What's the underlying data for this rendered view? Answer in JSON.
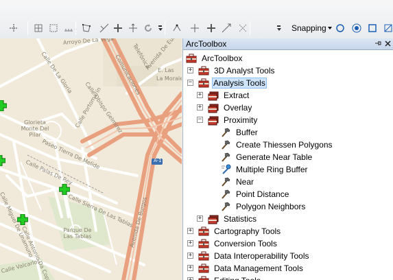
{
  "toolbar": {
    "snapping_label": "Snapping",
    "icons": [
      "pan-icon",
      "grid-icon",
      "measure-icon",
      "vertex-icon",
      "split-icon",
      "reshape-icon",
      "rotate-icon",
      "edit-vertices-icon",
      "snap-point-icon",
      "snap-end-icon",
      "snap-vertex-icon",
      "snap-edge-icon",
      "topology-icon"
    ]
  },
  "map": {
    "labels": [
      "Arroyo De La Vega",
      "Calle De La Gloria",
      "Calle Obispo Gelmirez",
      "Avenida De Europa",
      "Comunicaciones",
      "Telefónica",
      "E. Las",
      "La Moraleja",
      "Calle Portomarín",
      "Glorieta Monte Del Pilar",
      "Paseo Tierra De Melide",
      "Calle Palas De Rey",
      "Avenida De Burgos",
      "A-1",
      "Parque De Las Tablas",
      "Calle Sierra De Las Tablas",
      "Calle Miguel De Unamuno",
      "Calle Valcarlos",
      "Calle Antonio Da Coppola"
    ]
  },
  "panel": {
    "title": "ArcToolbox",
    "pin_icon": "pin-icon",
    "close_icon": "close-icon",
    "tree": [
      {
        "label": "ArcToolbox",
        "icon": "toolbox-icon",
        "level": 0,
        "expander": ""
      },
      {
        "label": "3D Analyst Tools",
        "icon": "toolbox-icon",
        "level": 1,
        "expander": "+"
      },
      {
        "label": "Analysis Tools",
        "icon": "toolbox-icon",
        "level": 1,
        "expander": "-",
        "selected": true
      },
      {
        "label": "Extract",
        "icon": "toolset-icon",
        "level": 2,
        "expander": "+"
      },
      {
        "label": "Overlay",
        "icon": "toolset-icon",
        "level": 2,
        "expander": "+"
      },
      {
        "label": "Proximity",
        "icon": "toolset-icon",
        "level": 2,
        "expander": "-"
      },
      {
        "label": "Buffer",
        "icon": "hammer-icon",
        "level": 3,
        "expander": ""
      },
      {
        "label": "Create Thiessen Polygons",
        "icon": "hammer-icon",
        "level": 3,
        "expander": ""
      },
      {
        "label": "Generate Near Table",
        "icon": "hammer-icon",
        "level": 3,
        "expander": ""
      },
      {
        "label": "Multiple Ring Buffer",
        "icon": "script-icon",
        "level": 3,
        "expander": ""
      },
      {
        "label": "Near",
        "icon": "hammer-icon",
        "level": 3,
        "expander": ""
      },
      {
        "label": "Point Distance",
        "icon": "hammer-icon",
        "level": 3,
        "expander": ""
      },
      {
        "label": "Polygon Neighbors",
        "icon": "hammer-icon",
        "level": 3,
        "expander": ""
      },
      {
        "label": "Statistics",
        "icon": "toolset-icon",
        "level": 2,
        "expander": "+"
      },
      {
        "label": "Cartography Tools",
        "icon": "toolbox-icon",
        "level": 1,
        "expander": "+"
      },
      {
        "label": "Conversion Tools",
        "icon": "toolbox-icon",
        "level": 1,
        "expander": "+"
      },
      {
        "label": "Data Interoperability Tools",
        "icon": "toolbox-icon",
        "level": 1,
        "expander": "+"
      },
      {
        "label": "Data Management Tools",
        "icon": "toolbox-icon",
        "level": 1,
        "expander": "+"
      },
      {
        "label": "Editing Tools",
        "icon": "toolbox-icon",
        "level": 1,
        "expander": "+"
      }
    ]
  },
  "colors": {
    "map_bg": "#f1eadb",
    "highway": "#e9a07e",
    "road": "#ffffff",
    "park": "#d9e6c3",
    "marker": "#22cc22",
    "selection": "#cde4fb"
  }
}
